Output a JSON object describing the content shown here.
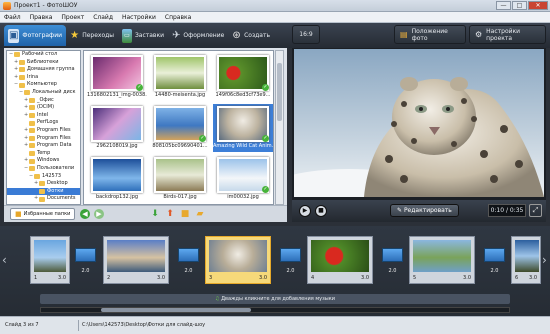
{
  "window": {
    "title": "Проект1 - ФотоШОУ",
    "buttons": [
      "—",
      "□",
      "✕"
    ]
  },
  "menu": [
    "Файл",
    "Правка",
    "Проект",
    "Слайд",
    "Настройки",
    "Справка"
  ],
  "tabs": [
    {
      "label": "Фотографии",
      "icon": "photos-icon",
      "active": true
    },
    {
      "label": "Переходы",
      "icon": "transitions-icon"
    },
    {
      "label": "Заставки",
      "icon": "intro-icon"
    },
    {
      "label": "Оформление",
      "icon": "design-icon"
    },
    {
      "label": "Создать",
      "icon": "create-icon"
    }
  ],
  "toolbar": {
    "aspect": "16:9",
    "photo_position": "Положение фото",
    "project_settings": "Настройки проекта"
  },
  "tree": [
    {
      "label": "Рабочий стол",
      "indent": 0,
      "exp": "−"
    },
    {
      "label": "Библиотеки",
      "indent": 1,
      "exp": "+"
    },
    {
      "label": "Домашняя группа",
      "indent": 1,
      "exp": "+"
    },
    {
      "label": "Irina",
      "indent": 1,
      "exp": "+"
    },
    {
      "label": "Компьютер",
      "indent": 1,
      "exp": "−"
    },
    {
      "label": "Локальный диск",
      "indent": 2,
      "exp": "−"
    },
    {
      "label": "_Офис",
      "indent": 3,
      "exp": "+"
    },
    {
      "label": "(DCIM)",
      "indent": 3,
      "exp": "+"
    },
    {
      "label": "Intel",
      "indent": 3,
      "exp": "+"
    },
    {
      "label": "PerfLogs",
      "indent": 3,
      "exp": ""
    },
    {
      "label": "Program Files",
      "indent": 3,
      "exp": "+"
    },
    {
      "label": "Program Files",
      "indent": 3,
      "exp": "+"
    },
    {
      "label": "Program Data",
      "indent": 3,
      "exp": "+"
    },
    {
      "label": "Temp",
      "indent": 3,
      "exp": ""
    },
    {
      "label": "Windows",
      "indent": 3,
      "exp": "+"
    },
    {
      "label": "Пользователи",
      "indent": 3,
      "exp": "−"
    },
    {
      "label": "142573",
      "indent": 4,
      "exp": "−"
    },
    {
      "label": "Desktop",
      "indent": 5,
      "exp": "+"
    },
    {
      "label": "Фотки",
      "indent": 5,
      "exp": "",
      "selected": true
    },
    {
      "label": "Documents",
      "indent": 5,
      "exp": "+"
    }
  ],
  "thumbnails": [
    {
      "caption": "1316802131_img-0038...",
      "check": true
    },
    {
      "caption": "14480-meisenta.jpg",
      "check": false
    },
    {
      "caption": "149f06c8ed3cf73e9...",
      "check": true
    },
    {
      "caption": "2962108019.jpg",
      "check": false
    },
    {
      "caption": "808105bc09690401...",
      "check": true
    },
    {
      "caption": "Amazing Wild Cat Anim...",
      "check": true,
      "selected": true
    },
    {
      "caption": "backdrop132.jpg",
      "check": false
    },
    {
      "caption": "Birds-017.jpg",
      "check": false
    },
    {
      "caption": "im00032.jpg",
      "check": true
    }
  ],
  "left_bottom": {
    "favorites": "Избранные папки"
  },
  "preview": {
    "edit_label": "Редактировать",
    "time": "0:10 / 0:35",
    "fullscreen": "⤢"
  },
  "slides": [
    {
      "num": "1",
      "duration": "3.0"
    },
    {
      "num": "2",
      "duration": "3.0"
    },
    {
      "num": "3",
      "duration": "3.0",
      "selected": true
    },
    {
      "num": "4",
      "duration": "3.0"
    },
    {
      "num": "5",
      "duration": "3.0"
    },
    {
      "num": "6",
      "duration": "3.0"
    }
  ],
  "transitions": [
    "2.0",
    "2.0",
    "2.0",
    "2.0",
    "2.0"
  ],
  "timeline": {
    "music_hint": "Дважды кликните для добавления музыки"
  },
  "status": {
    "slide": "Слайд 3 из 7",
    "path": "C:\\Users\\142573\\Desktop\\Фотки для слайд-шоу"
  }
}
